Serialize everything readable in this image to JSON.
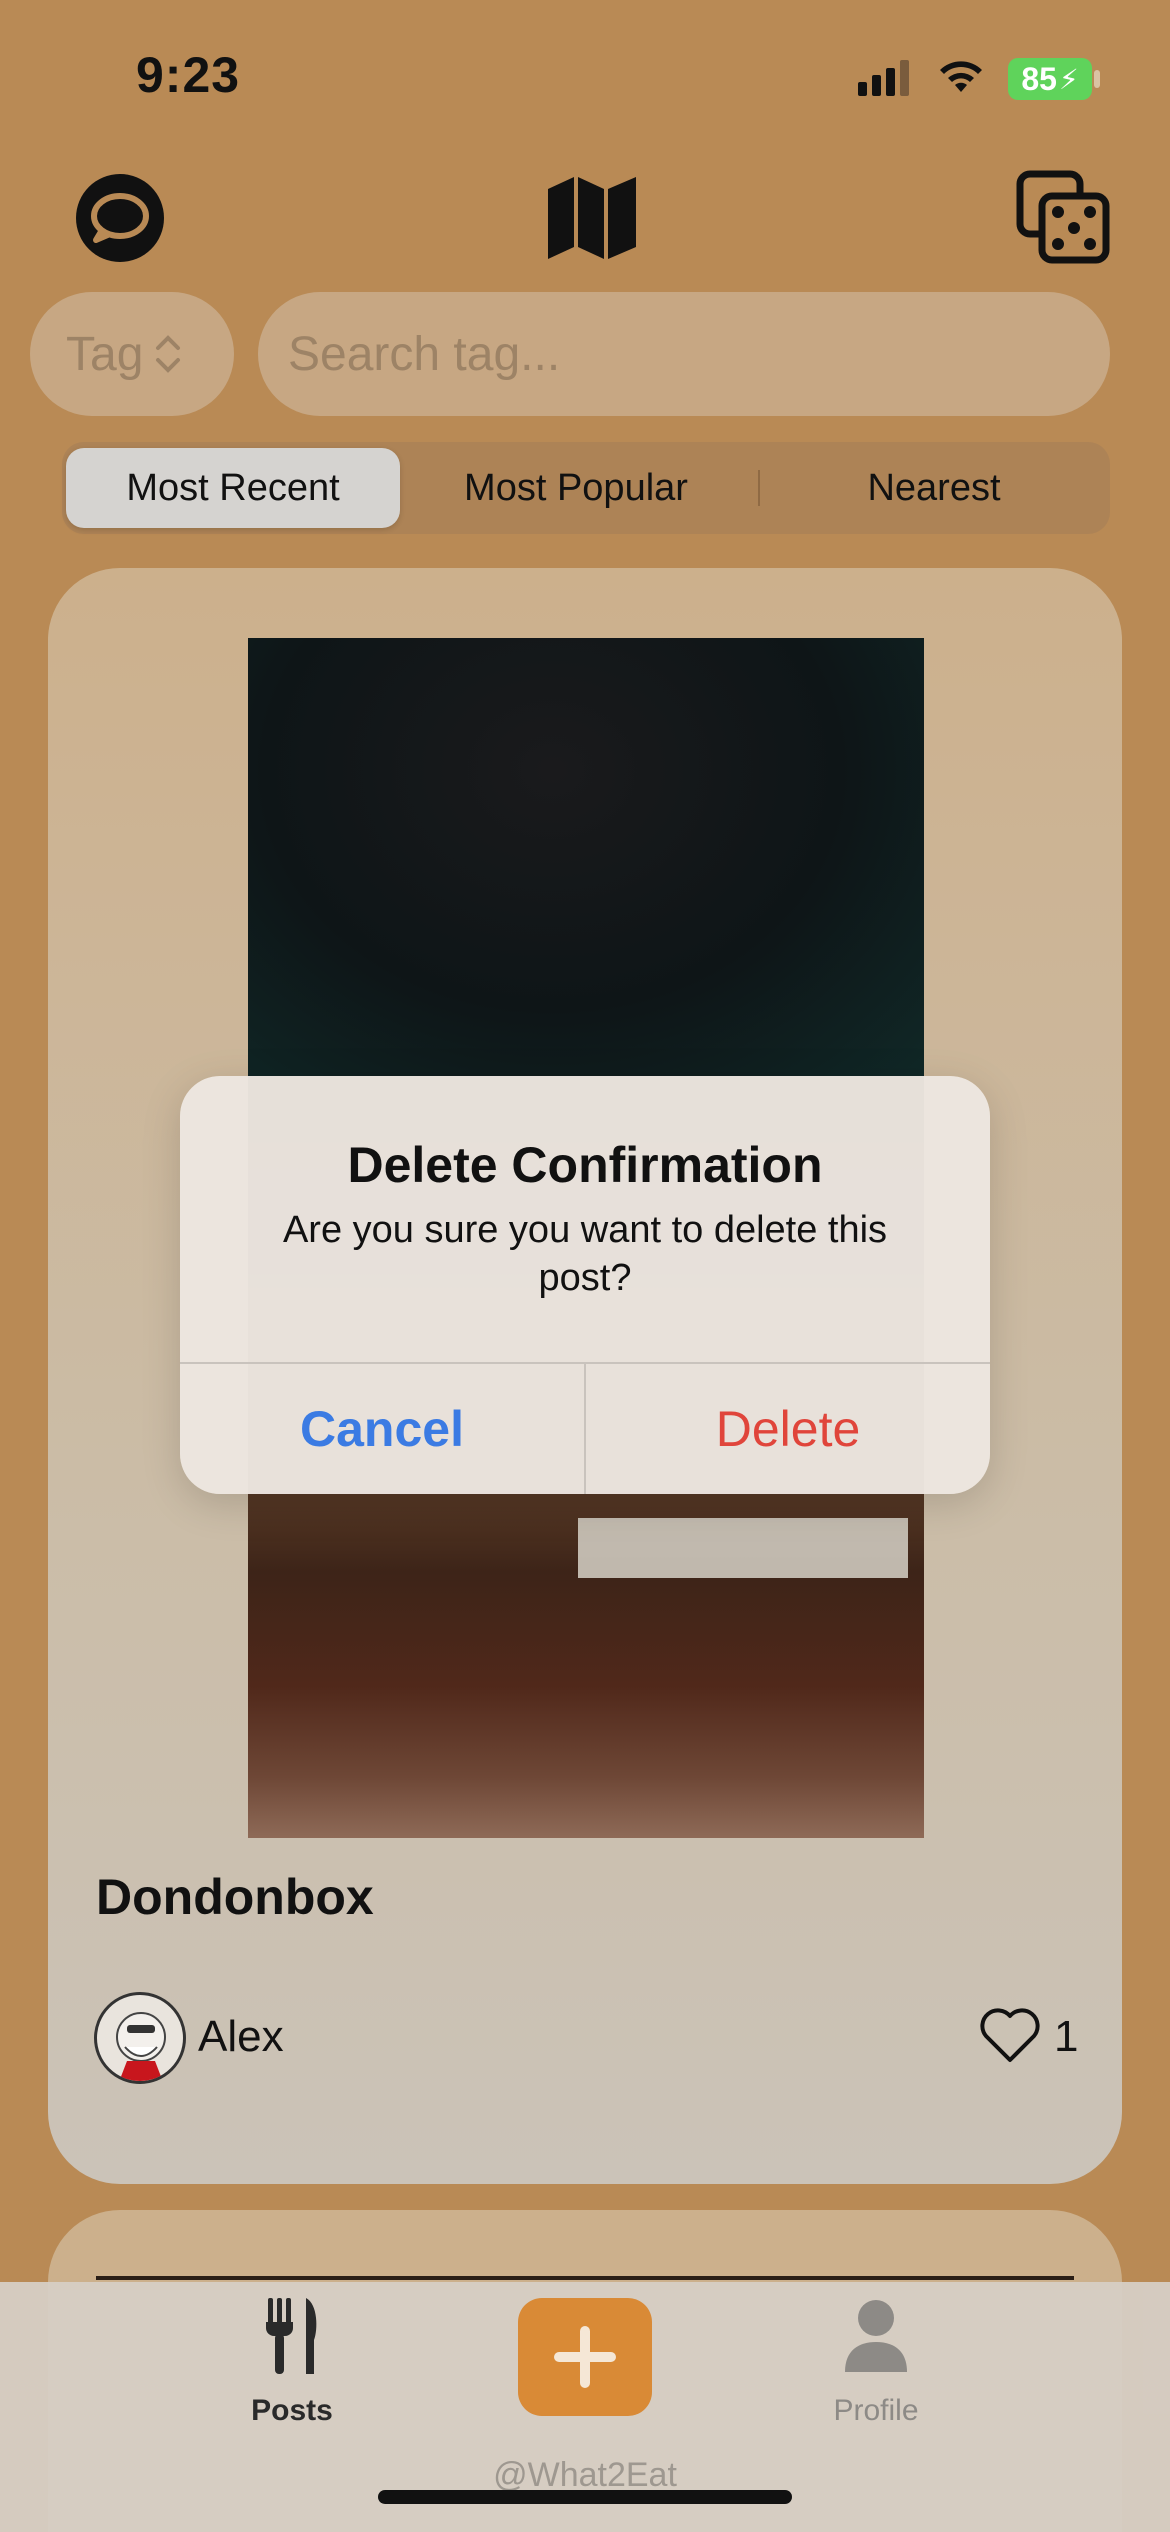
{
  "status_bar": {
    "time": "9:23",
    "battery": "85"
  },
  "search": {
    "tag_label": "Tag",
    "placeholder": "Search tag..."
  },
  "sort_tabs": [
    {
      "label": "Most Recent",
      "active": true
    },
    {
      "label": "Most Popular",
      "active": false
    },
    {
      "label": "Nearest",
      "active": false
    }
  ],
  "post": {
    "title": "Dondonbox",
    "author": "Alex",
    "likes": "1"
  },
  "alert": {
    "title": "Delete Confirmation",
    "message": "Are you sure you want to delete this post?",
    "cancel_label": "Cancel",
    "delete_label": "Delete"
  },
  "tab_bar": {
    "posts_label": "Posts",
    "profile_label": "Profile"
  },
  "footer": {
    "handle": "@What2Eat"
  },
  "colors": {
    "background": "#b98a55",
    "accent": "#d98a36",
    "cancel": "#3b7be3",
    "delete": "#e0453b"
  }
}
